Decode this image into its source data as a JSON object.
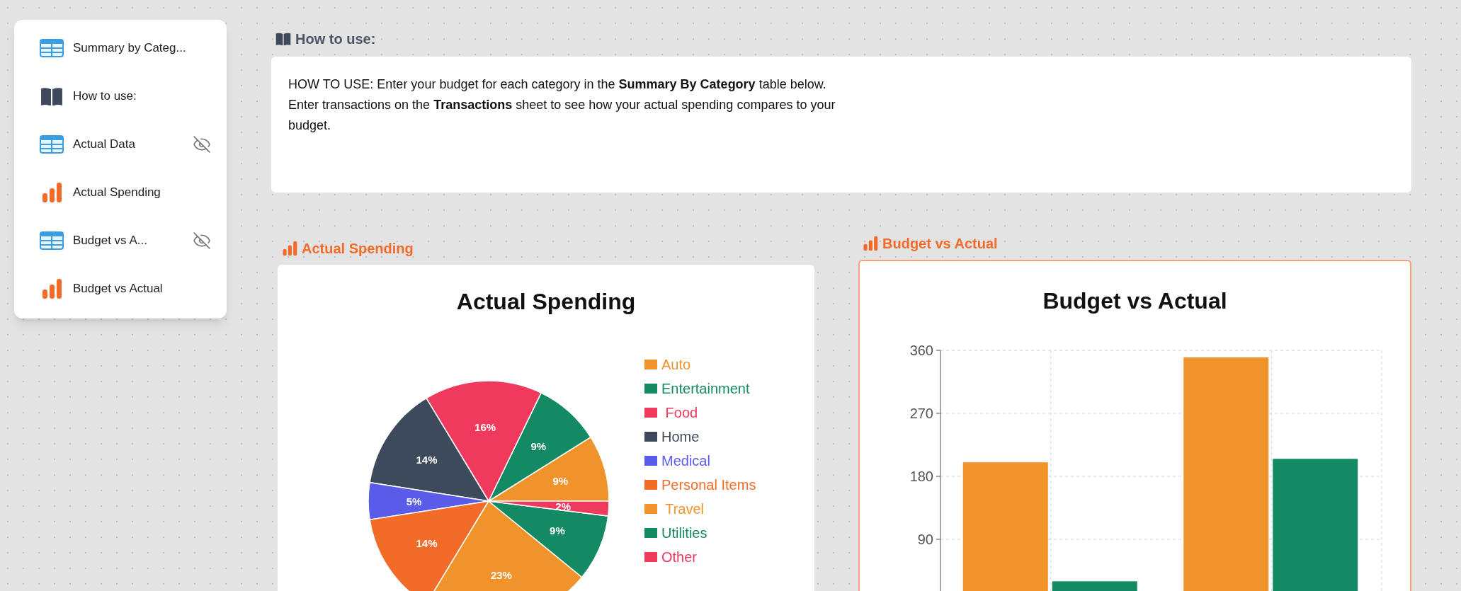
{
  "sidebar": {
    "items": [
      {
        "kind": "table",
        "label": "Summary by Categ...",
        "hidden": false
      },
      {
        "kind": "doc",
        "label": "How to use:",
        "hidden": false
      },
      {
        "kind": "table",
        "label": "Actual Data",
        "hidden": true
      },
      {
        "kind": "chart",
        "label": "Actual Spending",
        "hidden": false
      },
      {
        "kind": "table",
        "label": "Budget vs A...",
        "hidden": true
      },
      {
        "kind": "chart",
        "label": "Budget vs Actual",
        "hidden": false
      }
    ]
  },
  "how_to": {
    "heading": "How to use:",
    "text": "HOW TO USE: Enter your budget for each category in the **Summary By Category** table below. Enter transactions on the **Transactions** sheet to see how your actual spending compares to your budget."
  },
  "panels": [
    {
      "label": "Actual Spending",
      "selected": false,
      "chart_title": "Actual Spending",
      "chart_data": {
        "type": "pie",
        "categories": [
          "Auto",
          "Entertainment",
          " Food",
          "Home",
          "Medical",
          "Personal Items",
          " Travel",
          "Utilities",
          "Other"
        ],
        "values": [
          9,
          9,
          16,
          14,
          5,
          14,
          23,
          9,
          2
        ],
        "colors": [
          "#f0932b",
          "#138a63",
          "#ef3a5d",
          "#3d4a5c",
          "#5b5bea",
          "#f26b29",
          "#f0932b",
          "#138a63",
          "#ef3a5d"
        ],
        "value_labels": [
          "9%",
          "9%",
          "16%",
          "14%",
          "5%",
          "14%",
          "23%",
          "9%",
          "2%"
        ]
      }
    },
    {
      "label": "Budget vs Actual",
      "selected": true,
      "chart_title": "Budget vs Actual",
      "chart_data": {
        "type": "bar",
        "grid": true,
        "ylim": [
          0,
          360
        ],
        "yticks": [
          90,
          180,
          270,
          360
        ],
        "series": [
          {
            "color": "#f0932b",
            "values": [
              200,
              350
            ]
          },
          {
            "color": "#138a63",
            "values": [
              30,
              205
            ]
          }
        ]
      }
    }
  ]
}
